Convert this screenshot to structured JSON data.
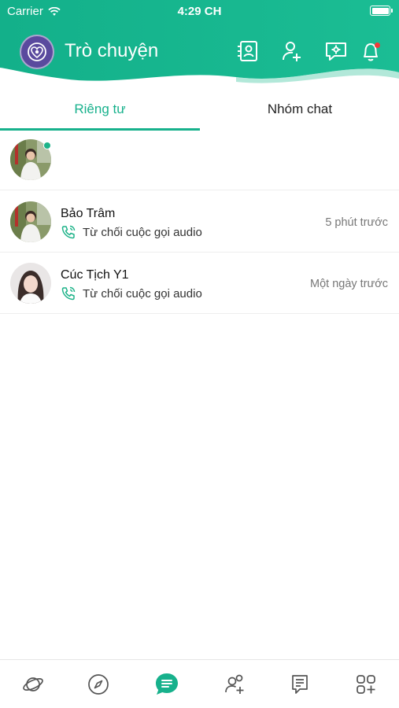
{
  "status_bar": {
    "carrier": "Carrier",
    "time": "4:29 CH"
  },
  "header": {
    "title": "Trò chuyện",
    "icons": [
      "contacts-icon",
      "add-friend-icon",
      "chat-settings-icon",
      "bell-icon"
    ],
    "accent": "#17b18c"
  },
  "tabs": [
    {
      "label": "Riêng tư",
      "active": true
    },
    {
      "label": "Nhóm chat",
      "active": false
    }
  ],
  "chats": [
    {
      "name": "Bảo Trâm",
      "message": "Từ chối cuộc gọi audio",
      "time": "5 phút trước"
    },
    {
      "name": "Cúc Tịch Y1",
      "message": "Từ chối cuộc gọi audio",
      "time": "Một ngày trước"
    }
  ],
  "bottom_nav": [
    "planet-icon",
    "compass-icon",
    "chat-icon",
    "friends-icon",
    "feed-icon",
    "apps-icon"
  ],
  "colors": {
    "accent": "#17b18c",
    "notification": "#f03a3a",
    "online": "#1eb389"
  }
}
